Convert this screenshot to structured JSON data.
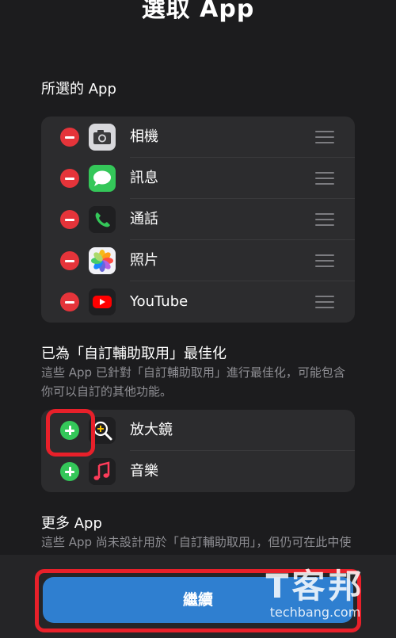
{
  "header": {
    "title": "選取 App"
  },
  "selected": {
    "title": "所選的 App",
    "apps": [
      {
        "label": "相機",
        "icon": "camera-icon"
      },
      {
        "label": "訊息",
        "icon": "messages-icon"
      },
      {
        "label": "通話",
        "icon": "phone-icon"
      },
      {
        "label": "照片",
        "icon": "photos-icon"
      },
      {
        "label": "YouTube",
        "icon": "youtube-icon"
      }
    ]
  },
  "optimized": {
    "title": "已為「自訂輔助取用」最佳化",
    "desc": "這些 App 已針對「自訂輔助取用」進行最佳化，可能包含你可以自訂的其他功能。",
    "apps": [
      {
        "label": "放大鏡",
        "icon": "magnifier-icon"
      },
      {
        "label": "音樂",
        "icon": "music-icon"
      }
    ]
  },
  "more": {
    "title": "更多 App",
    "desc": "這些 App 尚未設計用於「自訂輔助取用」，但仍可在此中使用。"
  },
  "footer": {
    "continue_label": "繼續"
  },
  "watermark": {
    "logo": "T客邦",
    "text": "techbang.com"
  },
  "colors": {
    "accent": "#2f7fd0",
    "remove": "#e5343a",
    "add": "#34c759",
    "highlight": "#e8202a"
  }
}
